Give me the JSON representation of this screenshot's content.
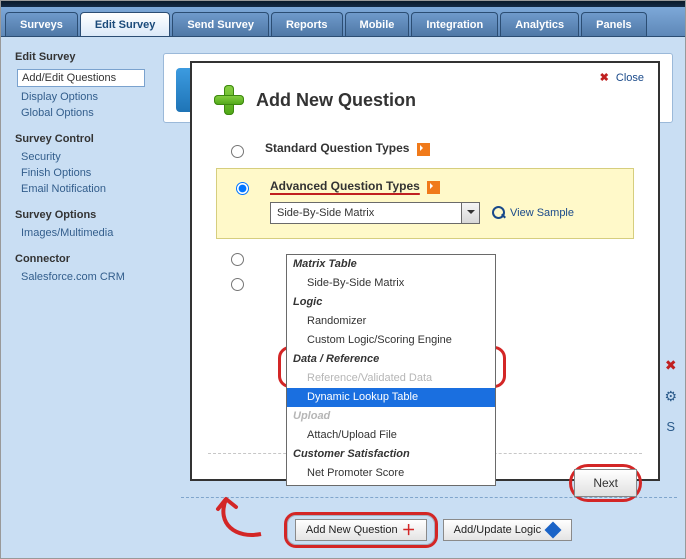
{
  "tabs": [
    "Surveys",
    "Edit Survey",
    "Send Survey",
    "Reports",
    "Mobile",
    "Integration",
    "Analytics",
    "Panels"
  ],
  "active_tab_index": 1,
  "sidebar": {
    "groups": [
      {
        "head": "Edit Survey",
        "items": [
          "Add/Edit Questions",
          "Display Options",
          "Global Options"
        ],
        "active_index": 0
      },
      {
        "head": "Survey Control",
        "items": [
          "Security",
          "Finish Options",
          "Email Notification"
        ]
      },
      {
        "head": "Survey Options",
        "items": [
          "Images/Multimedia"
        ]
      },
      {
        "head": "Connector",
        "items": [
          "Salesforce.com CRM"
        ]
      }
    ]
  },
  "dialog": {
    "close": "Close",
    "title": "Add New Question",
    "standard_label": "Standard Question Types",
    "advanced_label": "Advanced Question Types",
    "selected_option": "Side-By-Side Matrix",
    "view_sample": "View Sample",
    "next": "Next",
    "dropdown": {
      "groups": [
        {
          "name": "Matrix Table",
          "opts": [
            "Side-By-Side Matrix"
          ]
        },
        {
          "name": "Logic",
          "opts": [
            "Randomizer",
            "Custom Logic/Scoring Engine"
          ]
        },
        {
          "name": "Data / Reference",
          "opts": [
            "Reference/Validated Data",
            "Dynamic Lookup Table"
          ]
        },
        {
          "name": "Upload",
          "opts": [
            "Attach/Upload File"
          ]
        },
        {
          "name": "Customer Satisfaction",
          "opts": [
            "Net Promoter Score"
          ]
        }
      ],
      "highlight": "Dynamic Lookup Table"
    }
  },
  "bottom": {
    "add_new_question": "Add New Question",
    "add_update_logic": "Add/Update Logic"
  },
  "rightstrip": {
    "delete": "D",
    "settings": "S"
  }
}
